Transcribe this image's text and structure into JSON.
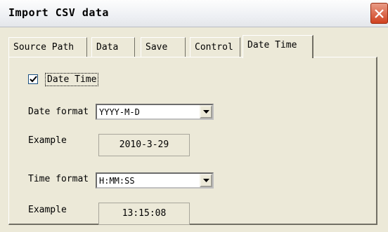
{
  "window": {
    "title": "Import CSV data"
  },
  "tabs": [
    {
      "label": "Source Path"
    },
    {
      "label": "Data"
    },
    {
      "label": "Save"
    },
    {
      "label": "Control"
    },
    {
      "label": "Date Time"
    }
  ],
  "date_time_panel": {
    "checkbox": {
      "label": "Date Time",
      "checked": true
    },
    "date_format": {
      "label": "Date format",
      "value": "YYYY-M-D"
    },
    "date_example": {
      "label": "Example",
      "value": "2010-3-29"
    },
    "time_format": {
      "label": "Time format",
      "value": "H:MM:SS"
    },
    "time_example": {
      "label": "Example",
      "value": "13:15:08"
    }
  },
  "colors": {
    "close_button": "#d0411f",
    "dialog_bg": "#ece9d8",
    "checkbox_border": "#1c5180"
  },
  "icons": {
    "close": "close-icon",
    "checkmark": "checkmark-icon",
    "dropdown": "chevron-down-icon"
  }
}
